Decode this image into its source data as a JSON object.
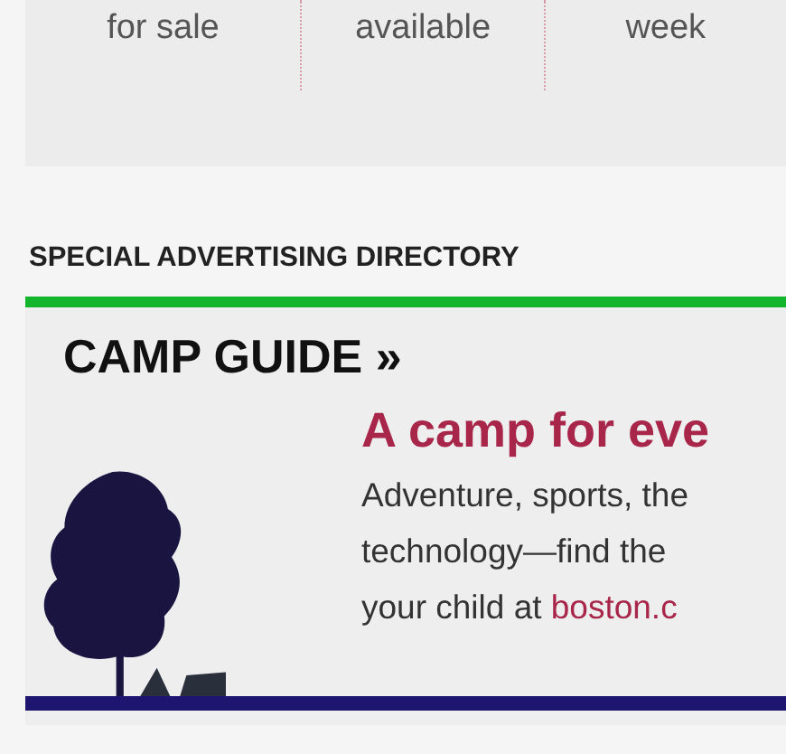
{
  "stats": [
    {
      "label": "for sale"
    },
    {
      "label": "available"
    },
    {
      "label": "week"
    }
  ],
  "directory": {
    "heading": "SPECIAL ADVERTISING DIRECTORY",
    "guide": {
      "title": "CAMP GUIDE »",
      "headline": "A camp for eve",
      "body_lines": [
        "Adventure, sports, the",
        "technology—find the"
      ],
      "last_line": "your child at",
      "link": "boston.c"
    }
  }
}
